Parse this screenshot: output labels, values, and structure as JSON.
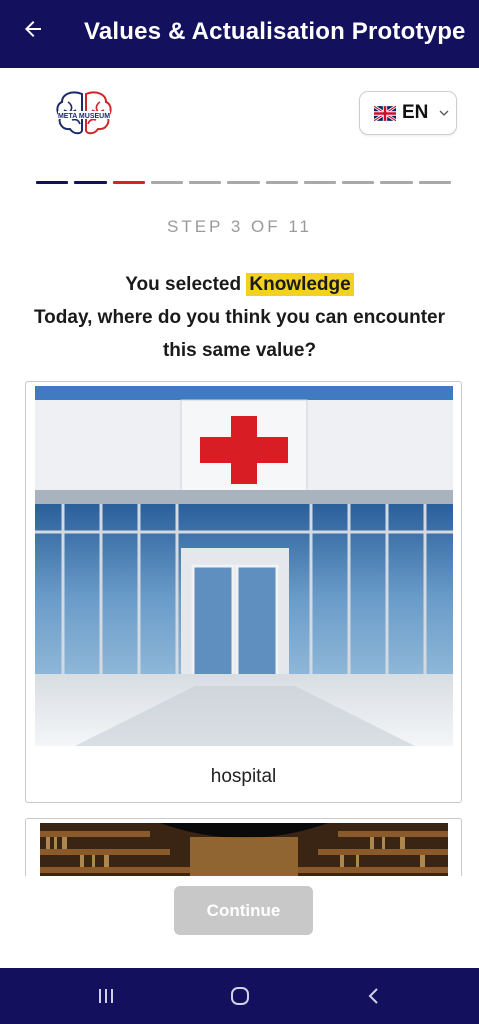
{
  "appbar": {
    "title": "Values & Actualisation Prototype",
    "back_icon": "arrow-left-icon"
  },
  "logo": {
    "text": "META MUSEUM"
  },
  "language": {
    "selected": "EN",
    "flag_icon": "uk-flag-icon"
  },
  "progress": {
    "total_steps": 11,
    "current_step": 3,
    "colors": {
      "done": "#13105e",
      "current": "#d0232a",
      "pending": "#a9a9a9"
    }
  },
  "step": {
    "label": "STEP 3 OF 11"
  },
  "prompt": {
    "prefix": "You selected",
    "value": "Knowledge",
    "question": "Today, where do you think you can encounter this same value?"
  },
  "options": [
    {
      "label": "hospital"
    }
  ],
  "actions": {
    "continue_label": "Continue"
  },
  "colors": {
    "brand": "#13105e",
    "highlight": "#f2d21c",
    "accent": "#d0232a"
  }
}
